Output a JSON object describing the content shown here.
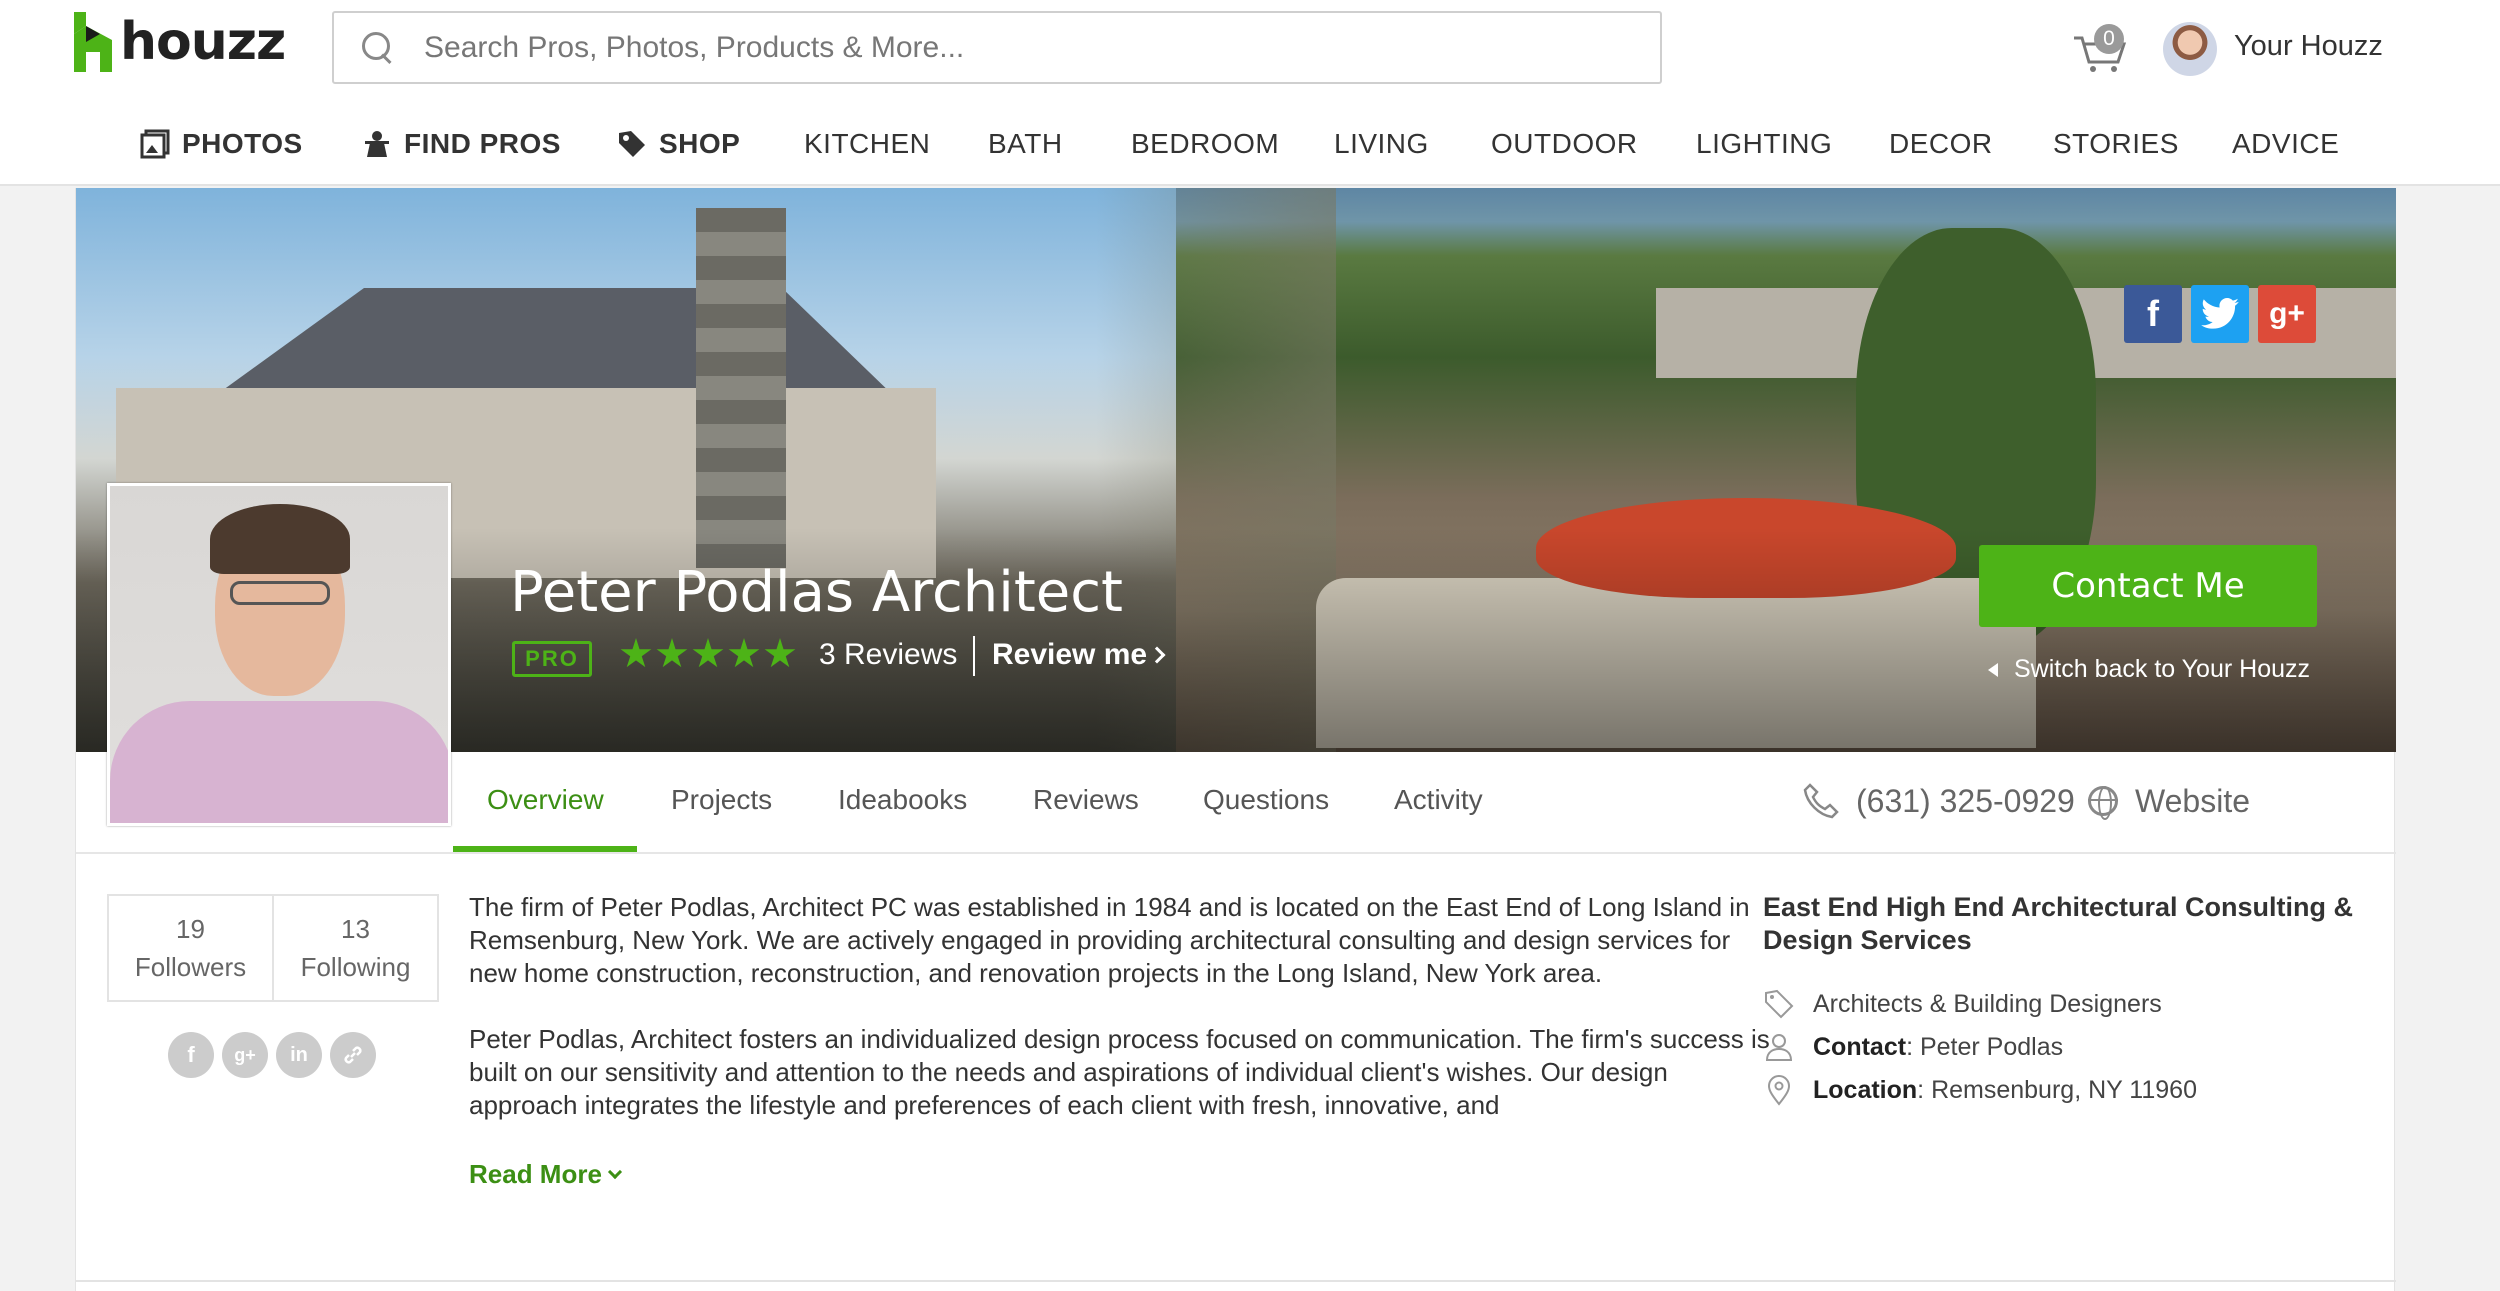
{
  "header": {
    "logo_text": "houzz",
    "search_placeholder": "Search Pros, Photos, Products & More...",
    "cart_count": "0",
    "user_label": "Your Houzz"
  },
  "nav": [
    {
      "label": "PHOTOS",
      "icon": "photos-icon"
    },
    {
      "label": "FIND PROS",
      "icon": "find-pros-icon"
    },
    {
      "label": "SHOP",
      "icon": "tag-icon"
    },
    {
      "label": "KITCHEN"
    },
    {
      "label": "BATH"
    },
    {
      "label": "BEDROOM"
    },
    {
      "label": "LIVING"
    },
    {
      "label": "OUTDOOR"
    },
    {
      "label": "LIGHTING"
    },
    {
      "label": "DECOR"
    },
    {
      "label": "STORIES"
    },
    {
      "label": "ADVICE"
    }
  ],
  "profile": {
    "name": "Peter Podlas Architect",
    "badge": "PRO",
    "rating": 5,
    "reviews": "3 Reviews",
    "review_me": "Review me",
    "contact_button": "Contact Me",
    "switch_back": "Switch back to Your Houzz",
    "social": {
      "facebook": "f",
      "twitter": "t",
      "googleplus": "g+"
    }
  },
  "tabs": [
    {
      "label": "Overview",
      "active": true
    },
    {
      "label": "Projects"
    },
    {
      "label": "Ideabooks"
    },
    {
      "label": "Reviews"
    },
    {
      "label": "Questions"
    },
    {
      "label": "Activity"
    }
  ],
  "contact": {
    "phone": "(631) 325-0929",
    "website": "Website"
  },
  "stats": {
    "followers_count": "19",
    "followers_label": "Followers",
    "following_count": "13",
    "following_label": "Following"
  },
  "share_icons": [
    "facebook-share-icon",
    "googleplus-share-icon",
    "linkedin-share-icon",
    "link-share-icon"
  ],
  "about": {
    "p1": "The firm of Peter Podlas, Architect PC was established in 1984 and is located on the East End of Long Island in Remsenburg, New York. We are actively engaged in providing architectural consulting and design services for new home construction, reconstruction, and renovation projects in the Long Island, New York area.",
    "p2": "Peter Podlas, Architect fosters an individualized design process focused on communication. The firm's success is built on our sensitivity and attention to the needs and aspirations of individual client's wishes. Our design approach integrates the lifestyle and preferences of each client with fresh, innovative, and",
    "read_more": "Read More"
  },
  "info": {
    "title": "East End High End Architectural Consulting & Design Services",
    "category": "Architects & Building Designers",
    "contact_label": "Contact",
    "contact_value": ": Peter Podlas",
    "location_label": "Location",
    "location_value": ": Remsenburg, NY 11960"
  },
  "colors": {
    "accent_green": "#4db317",
    "tab_active": "#3c8f14",
    "facebook": "#3b5998",
    "twitter": "#1da1f2",
    "googleplus": "#dd4b39"
  }
}
